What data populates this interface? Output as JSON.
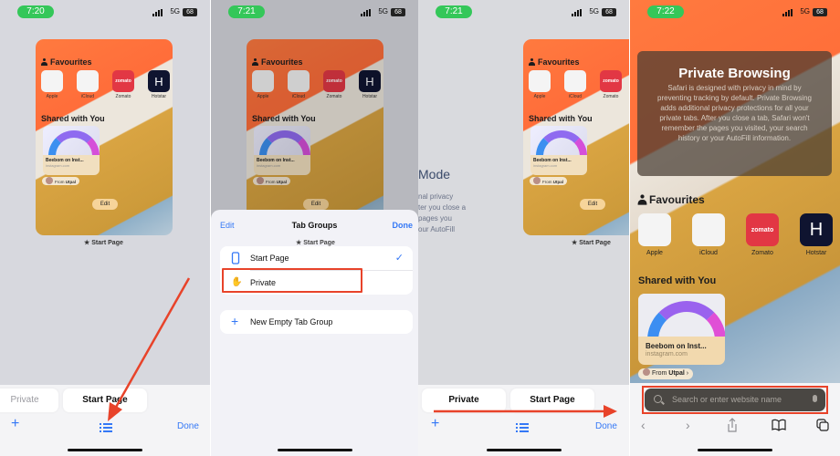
{
  "panels": [
    {
      "status": {
        "time": "7:20",
        "network": "5G",
        "battery": "68"
      },
      "card": {
        "favourites_title": "Favourites",
        "favourites": [
          {
            "label": "Apple",
            "icon": "apple-icon"
          },
          {
            "label": "iCloud",
            "icon": "apple-icon"
          },
          {
            "label": "Zomato",
            "icon": "zomato-icon",
            "icon_text": "zomato"
          },
          {
            "label": "Hotstar",
            "icon": "hotstar-icon",
            "icon_text": "H"
          }
        ],
        "shared_title": "Shared with You",
        "shared_item": {
          "title": "Beebom on Inst...",
          "url": "instagram.com",
          "from_prefix": "From",
          "from_name": "Utpal"
        },
        "edit_label": "Edit"
      },
      "card_label": "Start Page",
      "tabs": [
        "Private",
        "Start Page"
      ],
      "toolbar": {
        "add": "+",
        "done": "Done"
      }
    },
    {
      "status": {
        "time": "7:21",
        "network": "5G",
        "battery": "68"
      },
      "card_label": "Start Page",
      "card": {
        "edit_label": "Edit"
      },
      "sheet": {
        "edit": "Edit",
        "title": "Tab Groups",
        "done": "Done",
        "groups": [
          {
            "label": "Start Page",
            "icon": "phone-icon",
            "selected": true
          },
          {
            "label": "Private",
            "icon": "hand-icon",
            "selected": false
          }
        ],
        "new_group": "New Empty Tab Group"
      }
    },
    {
      "status": {
        "time": "7:21",
        "network": "5G",
        "battery": "68"
      },
      "private_mode_title": "Mode",
      "private_mode_text": [
        "nal privacy",
        "ter you close a",
        "pages you",
        "our AutoFill"
      ],
      "card_label": "Start Page",
      "card": {
        "edit_label": "Edit",
        "shared_item": {
          "title": "Beebom on Inst...",
          "from_prefix": "From",
          "from_name": "Utpal"
        }
      },
      "tabs": [
        "Private",
        "Start Page"
      ],
      "toolbar": {
        "add": "+",
        "done": "Done"
      }
    },
    {
      "status": {
        "time": "7:22",
        "network": "5G",
        "battery": "68"
      },
      "private_browsing": {
        "title": "Private Browsing",
        "text": "Safari is designed with privacy in mind by preventing tracking by default. Private Browsing adds additional privacy protections for all your private tabs. After you close a tab, Safari won't remember the pages you visited, your search history or your AutoFill information."
      },
      "favourites_title": "Favourites",
      "favourites": [
        {
          "label": "Apple",
          "icon": "apple-icon"
        },
        {
          "label": "iCloud",
          "icon": "apple-icon"
        },
        {
          "label": "Zomato",
          "icon": "zomato-icon",
          "icon_text": "zomato"
        },
        {
          "label": "Hotstar",
          "icon": "hotstar-icon",
          "icon_text": "H"
        }
      ],
      "shared_title": "Shared with You",
      "shared_item": {
        "title": "Beebom on Inst...",
        "url": "instagram.com",
        "from_prefix": "From",
        "from_name": "Utpal"
      },
      "search_placeholder": "Search or enter website name"
    }
  ],
  "colors": {
    "accent": "#3478f6",
    "highlight": "#e8432a",
    "status_green": "#34c759"
  }
}
